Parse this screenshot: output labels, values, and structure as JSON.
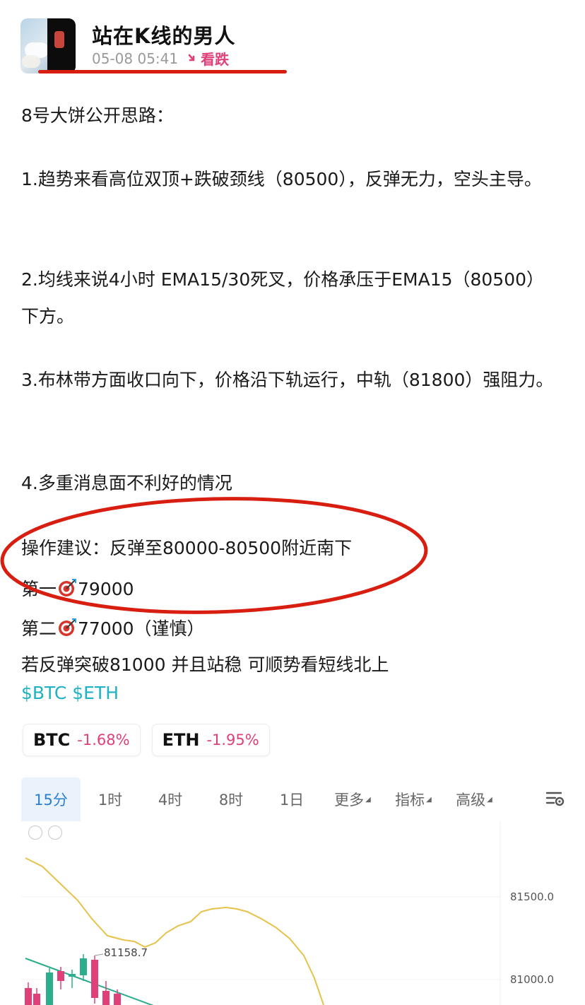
{
  "post": {
    "author": "站在K线的男人",
    "time": "05-08 05:41",
    "sentiment_icon": "down-arrow-icon",
    "sentiment": "看跌",
    "title": "8号大饼公开思路：",
    "p1": "1.趋势来看高位双顶+跌破颈线（80500），反弹无力，空头主导。",
    "p2": "2.均线来说4小时 EMA15/30死叉，价格承压于EMA15（80500）下方。",
    "p3": "3.布林带方面收口向下，价格沿下轨运行，中轨（81800）强阻力。",
    "p4": "4.多重消息面不利好的情况",
    "p5": "操作建议：反弹至80000-80500附近南下",
    "p6_prefix": "第一",
    "p6_value": "79000",
    "p7_prefix": "第二",
    "p7_value": "77000（谨慎）",
    "target_icon": "dart-target-icon",
    "p8": "若反弹突破81000 并且站稳 可顺势看短线北上",
    "tags": "$BTC $ETH"
  },
  "chips": [
    {
      "symbol": "BTC",
      "change": "-1.68%"
    },
    {
      "symbol": "ETH",
      "change": "-1.95%"
    }
  ],
  "tabs": {
    "t15m": "15分",
    "t1h": "1时",
    "t4h": "4时",
    "t8h": "8时",
    "t1d": "1日",
    "more": "更多",
    "indicators": "指标",
    "advanced": "高级"
  },
  "chart": {
    "y_labels": [
      "81500.0",
      "81000.0"
    ],
    "high_label": "81158.7"
  },
  "colors": {
    "bearish": "#e0407a",
    "link": "#1fb2c4",
    "active_tab": "#2a7fd0",
    "annotation_red": "#d81e10"
  }
}
